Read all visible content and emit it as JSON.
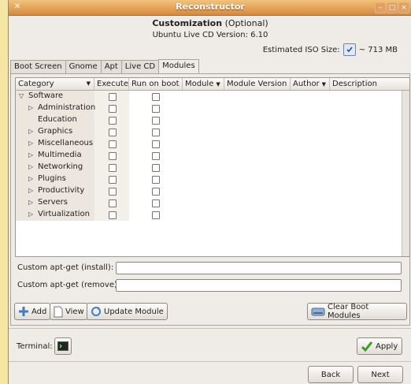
{
  "window": {
    "title": "Reconstructor"
  },
  "header": {
    "customization_label": "Customization",
    "optional_label": "(Optional)",
    "version_line": "Ubuntu Live CD Version: 6.10",
    "iso_label": "Estimated ISO Size:",
    "iso_value": "~ 713 MB"
  },
  "tabs": [
    "Boot Screen",
    "Gnome",
    "Apt",
    "Live CD",
    "Modules"
  ],
  "active_tab": "Modules",
  "table": {
    "columns": [
      "Category",
      "Execute",
      "Run on boot",
      "Module",
      "Module Version",
      "Author",
      "Description"
    ],
    "rows": [
      {
        "label": "Software",
        "expander": "down",
        "execute": false,
        "run_on_boot": false
      },
      {
        "label": "Administration",
        "expander": "right",
        "execute": false,
        "run_on_boot": false
      },
      {
        "label": "Education",
        "expander": "none",
        "execute": false,
        "run_on_boot": false
      },
      {
        "label": "Graphics",
        "expander": "right",
        "execute": false,
        "run_on_boot": false
      },
      {
        "label": "Miscellaneous",
        "expander": "right",
        "execute": false,
        "run_on_boot": false
      },
      {
        "label": "Multimedia",
        "expander": "right",
        "execute": false,
        "run_on_boot": false
      },
      {
        "label": "Networking",
        "expander": "right",
        "execute": false,
        "run_on_boot": false
      },
      {
        "label": "Plugins",
        "expander": "right",
        "execute": false,
        "run_on_boot": false
      },
      {
        "label": "Productivity",
        "expander": "right",
        "execute": false,
        "run_on_boot": false
      },
      {
        "label": "Servers",
        "expander": "right",
        "execute": false,
        "run_on_boot": false
      },
      {
        "label": "Virtualization",
        "expander": "right",
        "execute": false,
        "run_on_boot": false
      }
    ]
  },
  "fields": {
    "install_label": "Custom apt-get (install):",
    "install_value": "",
    "remove_label": "Custom apt-get (remove):",
    "remove_value": ""
  },
  "buttons": {
    "add": "Add",
    "view": "View",
    "update_module": "Update Module",
    "clear_boot_modules": "Clear Boot Modules",
    "apply": "Apply",
    "back": "Back",
    "next": "Next"
  },
  "terminal_label": "Terminal:",
  "colors": {
    "titlebar": "#d7893e",
    "background": "#f6e6a4",
    "window": "#efebe6"
  }
}
